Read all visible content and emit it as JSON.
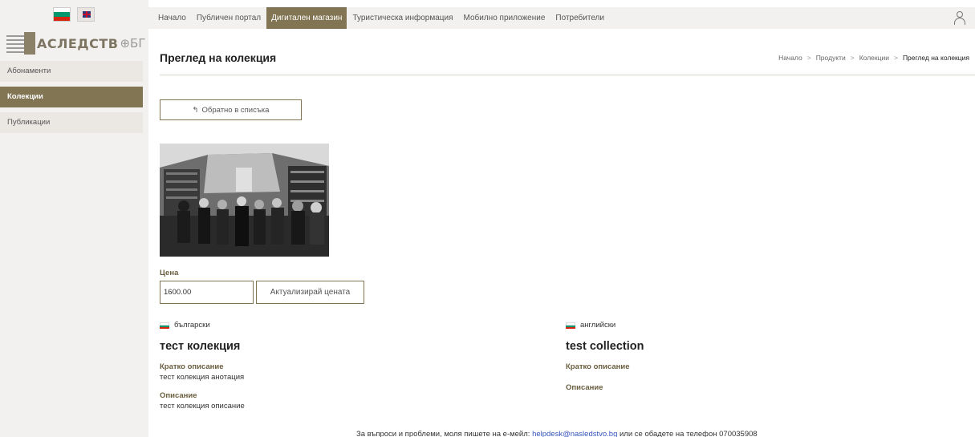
{
  "colors": {
    "accent": "#827553",
    "sidebar_bg": "#f3f1ef",
    "label": "#6b5e3f"
  },
  "logo": {
    "text": "АСЛЕДСТВ",
    "tail": "БГ"
  },
  "sidebar": {
    "items": [
      {
        "label": "Абонаменти",
        "active": false
      },
      {
        "label": "Колекции",
        "active": true
      },
      {
        "label": "Публикации",
        "active": false
      }
    ]
  },
  "nav": {
    "items": [
      {
        "label": "Начало"
      },
      {
        "label": "Публичен портал"
      },
      {
        "label": "Дигитален магазин",
        "active": true
      },
      {
        "label": "Туристическа информация"
      },
      {
        "label": "Мобилно приложение"
      },
      {
        "label": "Потребители"
      }
    ],
    "user_icon": "user-icon"
  },
  "page": {
    "title": "Преглед на колекция",
    "breadcrumb": [
      "Начало",
      "Продукти",
      "Колекции",
      "Преглед на колекция"
    ]
  },
  "back_button": {
    "icon": "↰",
    "label": "Обратно в списъка"
  },
  "price": {
    "label": "Цена",
    "value": "1600.00",
    "update_label": "Актуализирай цената"
  },
  "bg": {
    "lang": "български",
    "name": "тест колекция",
    "short_label": "Кратко описание",
    "short_value": "тест колекция анотация",
    "desc_label": "Описание",
    "desc_value": "тест колекция описание"
  },
  "en": {
    "lang": "английски",
    "name": "test collection",
    "short_label": "Кратко описание",
    "desc_label": "Описание"
  },
  "footer": {
    "prefix": "За въпроси и проблеми, моля пишете на е-мейл: ",
    "email": "helpdesk@nasledstvo.bg",
    "suffix": " или се обадете на телефон 070035908"
  }
}
